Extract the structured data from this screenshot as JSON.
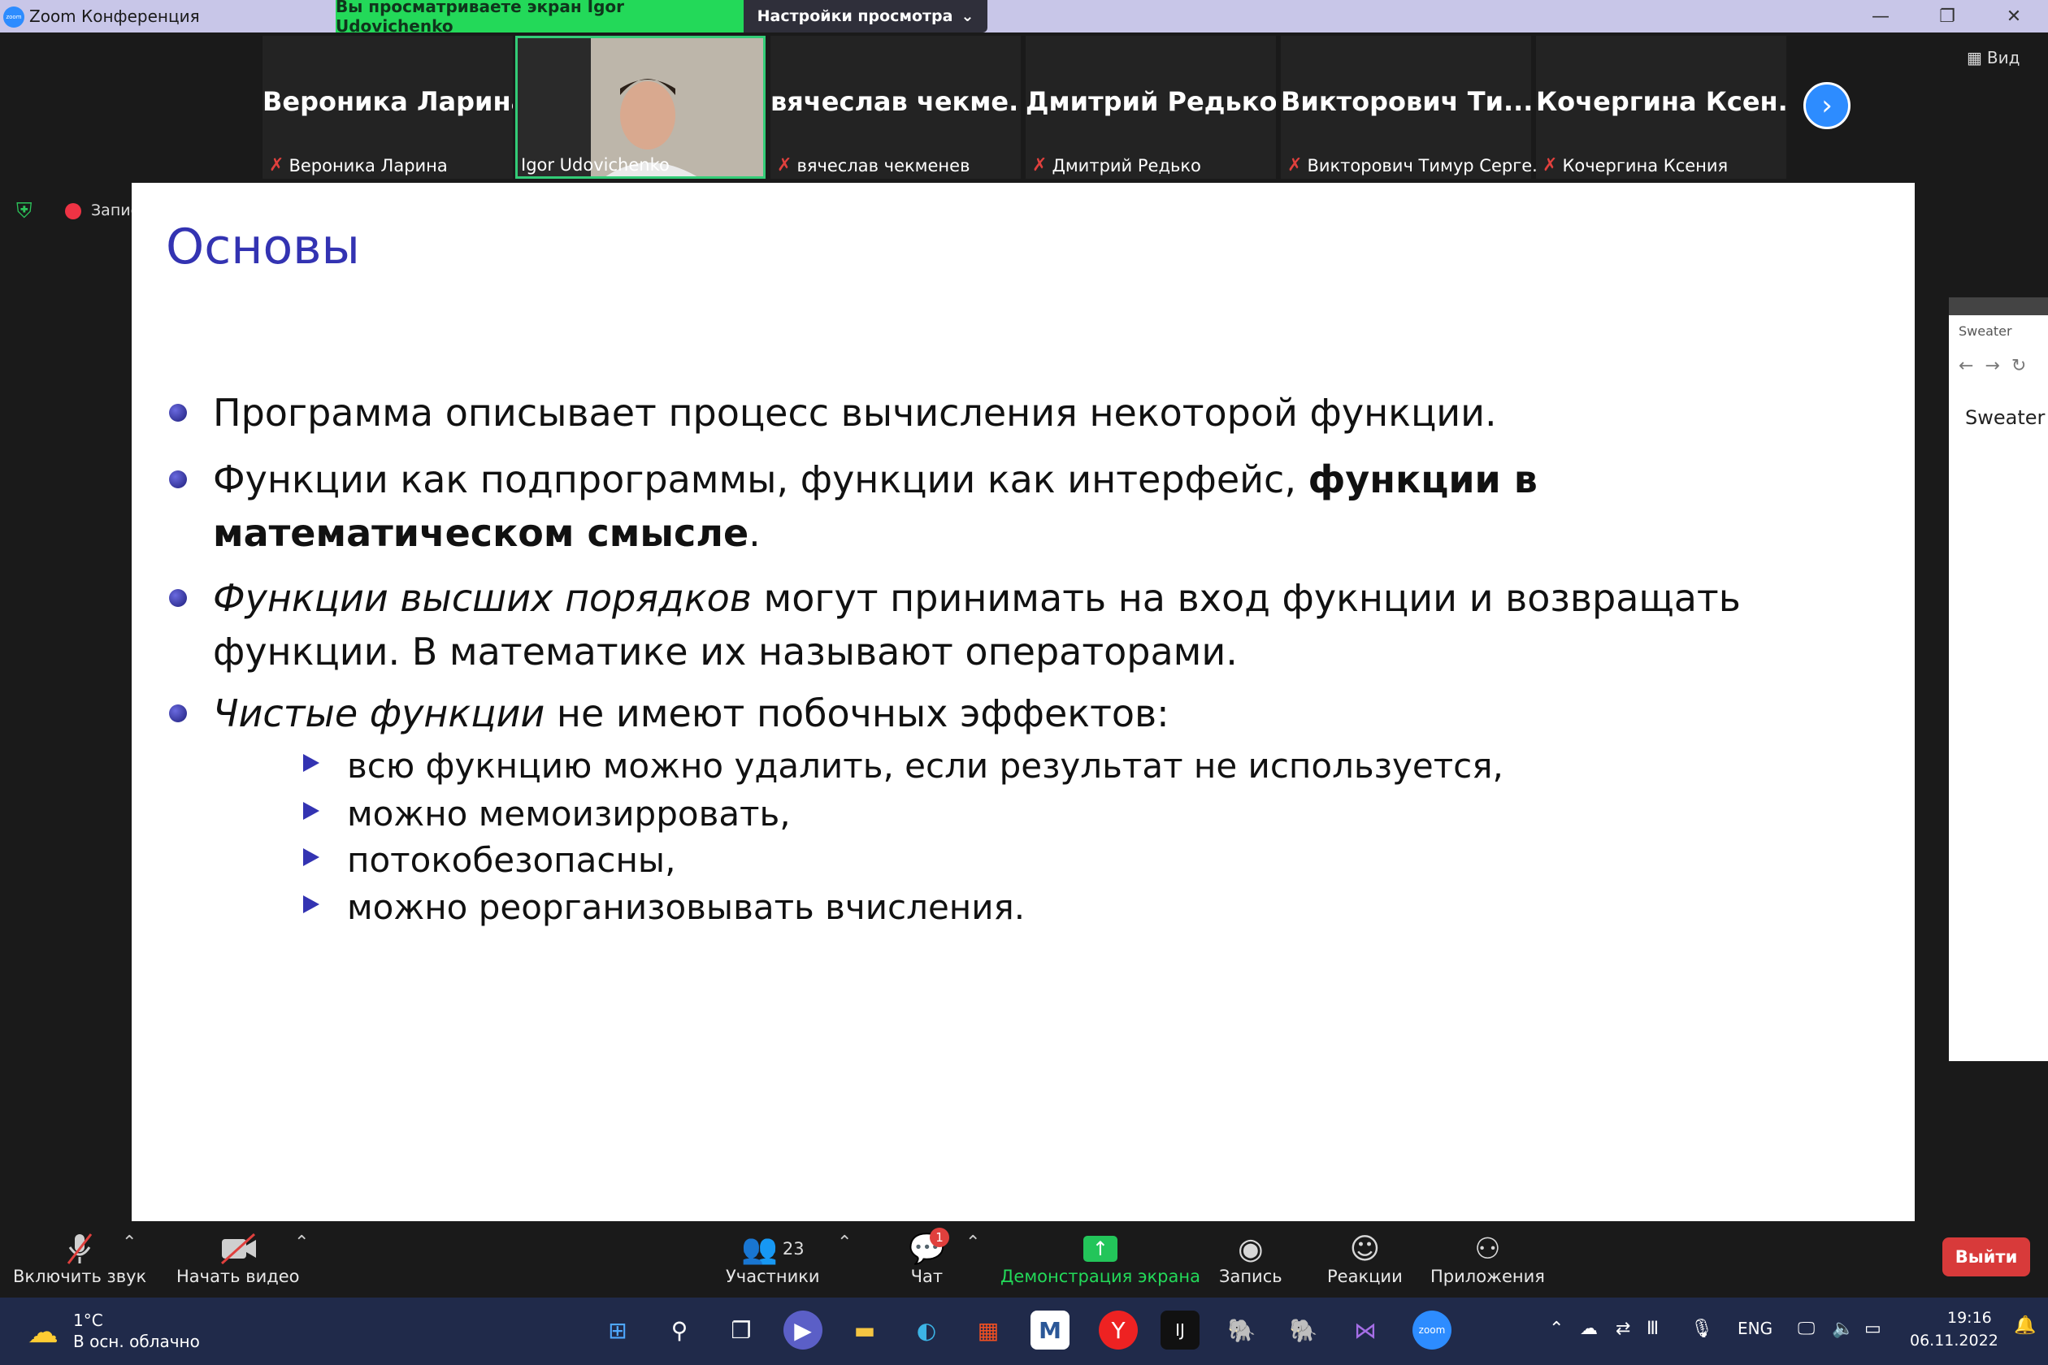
{
  "window": {
    "app_title": "Zoom Конференция",
    "logo_text": "zoom",
    "share_banner": "Вы просматриваете экран Igor Udovichenko",
    "view_settings": "Настройки просмотра",
    "view_settings_caret": "⌄",
    "min": "—",
    "restore": "❐",
    "close": "✕"
  },
  "gallery": {
    "view_label": "Вид",
    "tiles": [
      {
        "big": "Вероника Ларина",
        "label": "Вероника Ларина"
      },
      {
        "big": "",
        "label": "Igor Udovichenko"
      },
      {
        "big": "вячеслав чекме...",
        "label": "вячеслав чекменев"
      },
      {
        "big": "Дмитрий Редько",
        "label": "Дмитрий Редько"
      },
      {
        "big": "Викторович Ти...",
        "label": "Викторович Тимур Серге..."
      },
      {
        "big": "Кочергина Ксен...",
        "label": "Кочергина Ксения"
      }
    ],
    "next": "›"
  },
  "indicators": {
    "recording_label": "Запис"
  },
  "slide": {
    "title": "Основы",
    "b1": "Программа описывает процесс вычисления некоторой функции.",
    "b2_plain": "Функции как подпрограммы, функции как интерфейс, ",
    "b2_bold": "функции в математическом смысле",
    "b2_end": ".",
    "b3_italic": "Функции высших порядков",
    "b3_rest": " могут принимать на вход фукнции и возвращать функции. В математике их называют операторами.",
    "b4_italic": "Чистые функции",
    "b4_rest": " не имеют побочных эффектов:",
    "subs": [
      "всю фукнцию можно удалить, если результат не используется,",
      "можно мемоизирровать,",
      "потокобезопасны,",
      "можно реорганизовывать вчисления."
    ]
  },
  "side_browser": {
    "title": "Sweater",
    "heading": "Sweater"
  },
  "toolbar": {
    "unmute": "Включить звук",
    "start_video": "Начать видео",
    "participants": "Участники",
    "participants_count": "23",
    "chat": "Чат",
    "chat_badge": "1",
    "share": "Демонстрация экрана",
    "record": "Запись",
    "reactions": "Реакции",
    "apps": "Приложения",
    "leave": "Выйти",
    "caret": "⌃"
  },
  "taskbar": {
    "temp": "1°C",
    "condition": "В осн. облачно",
    "lang": "ENG",
    "time": "19:16",
    "date": "06.11.2022"
  },
  "colors": {
    "accent": "#2d8cff",
    "share_green": "#23d959",
    "slide_title": "#3333b2",
    "leave_red": "#d83a3a"
  }
}
